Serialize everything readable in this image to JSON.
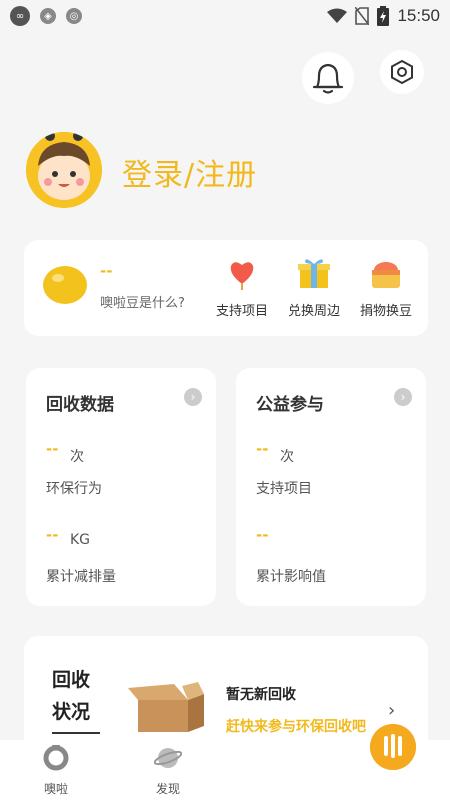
{
  "status_bar": {
    "time": "15:50",
    "left_icons": [
      "infinity-app-icon",
      "shield-app-icon",
      "chrome-app-icon"
    ],
    "right_icons": [
      "wifi-icon",
      "sim-off-icon",
      "battery-charging-icon"
    ]
  },
  "header": {
    "icons": [
      "bell-icon",
      "settings-icon"
    ]
  },
  "user": {
    "login_label": "登录/注册"
  },
  "beans": {
    "count": "--",
    "question": "噢啦豆是什么?",
    "actions": [
      {
        "label": "支持项目",
        "icon": "balloon-heart-icon"
      },
      {
        "label": "兑换周边",
        "icon": "gift-box-icon"
      },
      {
        "label": "捐物换豆",
        "icon": "donation-box-icon"
      }
    ]
  },
  "recycle_data": {
    "title": "回收数据",
    "value1": "--",
    "unit1": "次",
    "label1": "环保行为",
    "value2": "--",
    "unit2": "KG",
    "label2": "累计减排量"
  },
  "charity": {
    "title": "公益参与",
    "value1": "--",
    "unit1": "次",
    "label1": "支持项目",
    "value2": "--",
    "label2": "累计影响值"
  },
  "recycle_status": {
    "title_line1": "回收",
    "title_line2": "状况",
    "none_text": "暂无新回收",
    "cta_text": "赶快来参与环保回收吧"
  },
  "tabbar": {
    "tabs": [
      {
        "label": "噢啦",
        "icon": "ring-icon"
      },
      {
        "label": "发现",
        "icon": "planet-icon"
      }
    ]
  },
  "colors": {
    "accent": "#f2b91f",
    "background": "#f5f5f5",
    "card": "#ffffff"
  }
}
